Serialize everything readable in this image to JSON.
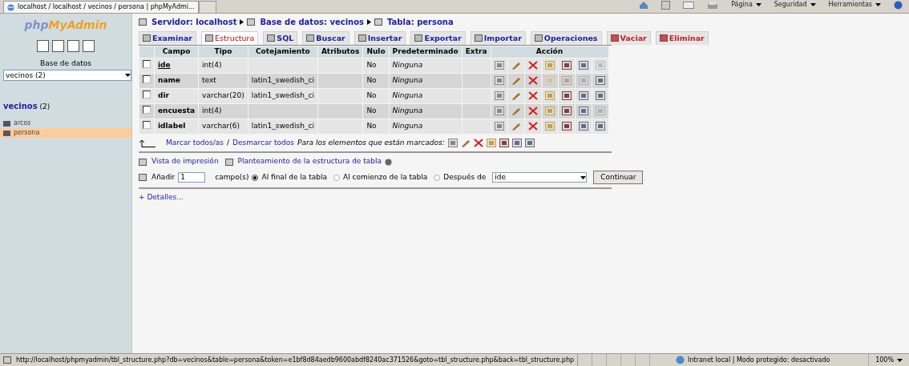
{
  "browser": {
    "tab_title": "localhost / localhost / vecinos / persona | phpMyAdmi...",
    "toolbar": [
      "Página",
      "Seguridad",
      "Herramientas"
    ]
  },
  "sidebar": {
    "logo_a": "php",
    "logo_b": "MyAdmin",
    "db_label": "Base de datos",
    "db_select": "vecinos (2)",
    "db_name": "vecinos",
    "db_count": "(2)",
    "tables": [
      {
        "name": "arcos",
        "selected": false
      },
      {
        "name": "persona",
        "selected": true
      }
    ]
  },
  "breadcrumb": [
    {
      "label": "Servidor: localhost"
    },
    {
      "label": "Base de datos: vecinos"
    },
    {
      "label": "Tabla: persona"
    }
  ],
  "tabs": [
    {
      "label": "Examinar",
      "selected": false,
      "kind": "normal"
    },
    {
      "label": "Estructura",
      "selected": true,
      "kind": "normal"
    },
    {
      "label": "SQL",
      "selected": false,
      "kind": "normal"
    },
    {
      "label": "Buscar",
      "selected": false,
      "kind": "normal"
    },
    {
      "label": "Insertar",
      "selected": false,
      "kind": "normal"
    },
    {
      "label": "Exportar",
      "selected": false,
      "kind": "normal"
    },
    {
      "label": "Importar",
      "selected": false,
      "kind": "normal"
    },
    {
      "label": "Operaciones",
      "selected": false,
      "kind": "normal"
    },
    {
      "label": "Vaciar",
      "selected": false,
      "kind": "danger"
    },
    {
      "label": "Eliminar",
      "selected": false,
      "kind": "danger"
    }
  ],
  "table": {
    "columns": [
      "Campo",
      "Tipo",
      "Cotejamiento",
      "Atributos",
      "Nulo",
      "Predeterminado",
      "Extra",
      "Acción"
    ],
    "rows": [
      {
        "checked": false,
        "field": "ide",
        "primary": true,
        "type": "int(4)",
        "collation": "",
        "null": "No",
        "default": "Ninguna",
        "actions": [
          true,
          true,
          true,
          true,
          true,
          true,
          false
        ]
      },
      {
        "checked": false,
        "field": "name",
        "primary": false,
        "type": "text",
        "collation": "latin1_swedish_ci",
        "null": "No",
        "default": "Ninguna",
        "actions": [
          true,
          true,
          true,
          false,
          false,
          false,
          true
        ]
      },
      {
        "checked": false,
        "field": "dir",
        "primary": false,
        "type": "varchar(20)",
        "collation": "latin1_swedish_ci",
        "null": "No",
        "default": "Ninguna",
        "actions": [
          true,
          true,
          true,
          true,
          true,
          true,
          true
        ]
      },
      {
        "checked": false,
        "field": "encuesta",
        "primary": false,
        "type": "int(4)",
        "collation": "",
        "null": "No",
        "default": "Ninguna",
        "actions": [
          true,
          true,
          true,
          true,
          true,
          true,
          false
        ]
      },
      {
        "checked": false,
        "field": "idlabel",
        "primary": false,
        "type": "varchar(6)",
        "collation": "latin1_swedish_ci",
        "null": "No",
        "default": "Ninguna",
        "actions": [
          true,
          true,
          true,
          true,
          true,
          true,
          true
        ]
      }
    ]
  },
  "mark_all": "Marcar todos/as",
  "separator": "/",
  "unmark_all": "Desmarcar todos",
  "with_selected": "Para los elementos que están marcados:",
  "print_view": "Vista de impresión",
  "propose": "Planteamiento de la estructura de tabla",
  "add": {
    "label": "Añadir",
    "value": "1",
    "suffix": "campo(s)",
    "options": [
      {
        "label": "Al final de la tabla",
        "selected": true
      },
      {
        "label": "Al comienzo de la tabla",
        "selected": false
      },
      {
        "label": "Después de",
        "selected": false
      }
    ],
    "after_field": "ide",
    "button": "Continuar"
  },
  "details": "+ Detalles...",
  "status_bar": {
    "url": "http://localhost/phpmyadmin/tbl_structure.php?db=vecinos&table=persona&token=e1bf8d84aedb9600abdf8240ac371526&goto=tbl_structure.php&back=tbl_structure.php",
    "zone": "Intranet local | Modo protegido: desactivado",
    "zoom": "100%"
  }
}
